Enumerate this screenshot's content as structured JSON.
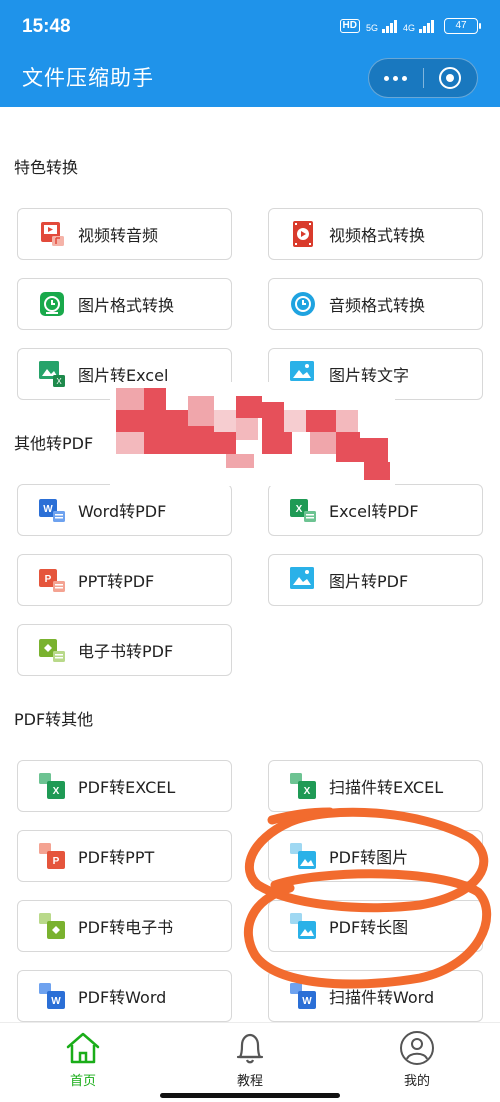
{
  "status_bar": {
    "time": "15:48",
    "hd": "HD",
    "net1": "5G",
    "net2": "4G",
    "battery": "47"
  },
  "header": {
    "title": "文件压缩助手",
    "more_icon": "more-dots-icon",
    "close_icon": "target-icon"
  },
  "sections": [
    {
      "title": "特色转换",
      "items": [
        {
          "label": "视频转音频",
          "icon": "video-to-audio-icon"
        },
        {
          "label": "视频格式转换",
          "icon": "video-format-icon"
        },
        {
          "label": "图片格式转换",
          "icon": "image-format-icon"
        },
        {
          "label": "音频格式转换",
          "icon": "audio-format-icon"
        },
        {
          "label": "图片转Excel",
          "icon": "image-to-excel-icon"
        },
        {
          "label": "图片转文字",
          "icon": "image-to-text-icon"
        }
      ]
    },
    {
      "title": "其他转PDF",
      "items": [
        {
          "label": "Word转PDF",
          "icon": "word-to-pdf-icon"
        },
        {
          "label": "Excel转PDF",
          "icon": "excel-to-pdf-icon"
        },
        {
          "label": "PPT转PDF",
          "icon": "ppt-to-pdf-icon"
        },
        {
          "label": "图片转PDF",
          "icon": "image-to-pdf-icon"
        },
        {
          "label": "电子书转PDF",
          "icon": "ebook-to-pdf-icon"
        }
      ]
    },
    {
      "title": "PDF转其他",
      "items": [
        {
          "label": "PDF转EXCEL",
          "icon": "pdf-to-excel-icon"
        },
        {
          "label": "扫描件转EXCEL",
          "icon": "scan-to-excel-icon"
        },
        {
          "label": "PDF转PPT",
          "icon": "pdf-to-ppt-icon"
        },
        {
          "label": "PDF转图片",
          "icon": "pdf-to-image-icon"
        },
        {
          "label": "PDF转电子书",
          "icon": "pdf-to-ebook-icon"
        },
        {
          "label": "PDF转长图",
          "icon": "pdf-to-long-image-icon"
        },
        {
          "label": "PDF转Word",
          "icon": "pdf-to-word-icon"
        },
        {
          "label": "扫描件转Word",
          "icon": "scan-to-word-icon"
        }
      ]
    }
  ],
  "tabbar": {
    "tabs": [
      {
        "label": "首页",
        "icon": "home-icon",
        "active": true
      },
      {
        "label": "教程",
        "icon": "bell-icon",
        "active": false
      },
      {
        "label": "我的",
        "icon": "user-icon",
        "active": false
      }
    ]
  },
  "colors": {
    "header": "#1f93ea",
    "active_tab": "#1aad19",
    "annotation": "#f26b2e",
    "redaction": "#e6505a"
  }
}
